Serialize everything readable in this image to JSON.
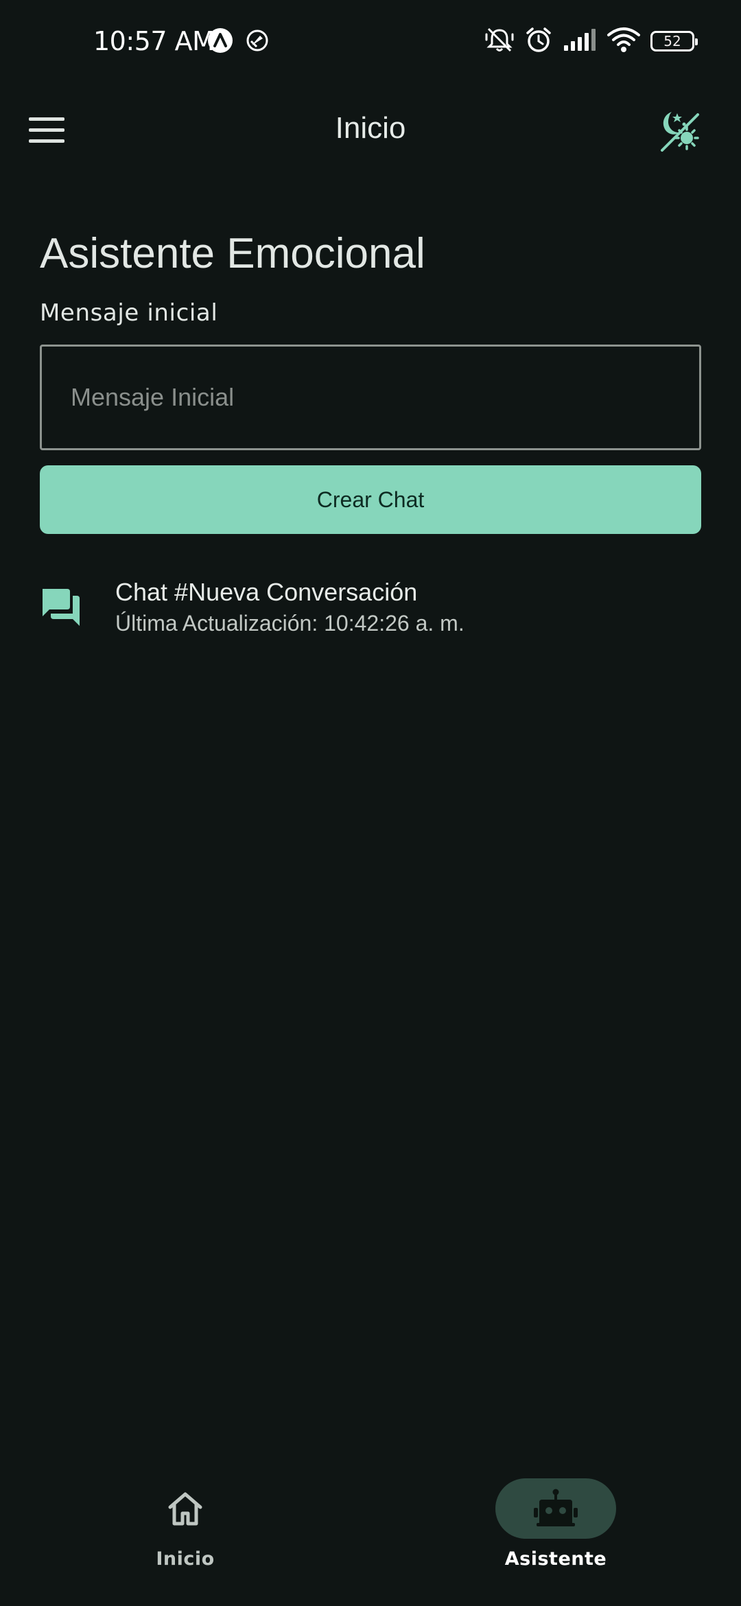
{
  "status_bar": {
    "time": "10:57 AM",
    "battery_level": "52",
    "battery_fraction": 0.52
  },
  "app_bar": {
    "title": "Inicio",
    "menu_icon": "hamburger-menu-icon",
    "theme_icon": "theme-toggle-icon"
  },
  "main": {
    "heading": "Asistente Emocional",
    "field_label": "Mensaje inicial",
    "field_placeholder": "Mensaje Inicial",
    "field_value": "",
    "create_button_label": "Crear Chat",
    "chats": [
      {
        "title": "Chat #Nueva Conversación",
        "subtitle": "Última Actualización: 10:42:26 a. m.",
        "icon": "forum-icon"
      }
    ]
  },
  "bottom_nav": {
    "items": [
      {
        "label": "Inicio",
        "icon": "home-icon",
        "selected": false
      },
      {
        "label": "Asistente",
        "icon": "robot-icon",
        "selected": true
      }
    ]
  },
  "colors": {
    "background": "#0f1514",
    "accent": "#86d6bb",
    "on_accent": "#0d2b22",
    "selected_pill": "#2f4a41",
    "text_primary": "#e2e7e4",
    "outline": "#8d938f"
  }
}
